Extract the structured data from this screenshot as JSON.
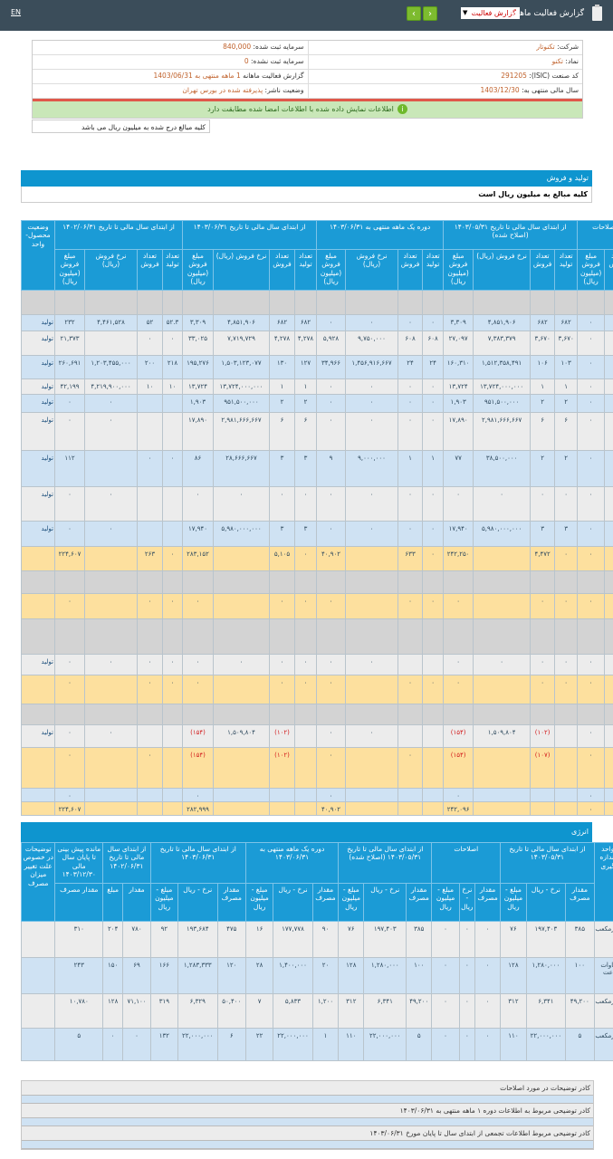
{
  "header": {
    "lang_toggle": "EN",
    "title": "گزارش فعالیت ماهانه",
    "report_select": "گزارش فعالیت",
    "prev_icon": "chevron-left-icon",
    "next_icon": "chevron-right-icon"
  },
  "info": {
    "company_label": "شرکت:",
    "company": "تکنوتار",
    "symbol_label": "نماد:",
    "symbol": "تکنو",
    "isic_label": "کد صنعت (ISIC):",
    "isic": "291205",
    "fiscal_label": "سال مالی منتهی به:",
    "fiscal": "1403/12/30",
    "reg_capital_label": "سرمایه ثبت شده:",
    "reg_capital": "840,000",
    "unreg_capital_label": "سرمایه ثبت نشده:",
    "unreg_capital": "0",
    "report_label": "گزارش فعالیت ماهانه",
    "report_value": "1 ماهه منتهی به 1403/06/31",
    "status_label": "وضعیت ناشر:",
    "status": "پذیرفته شده در بورس تهران",
    "verify_message": "اطلاعات نمایش داده شده با اطلاعات امضا شده مطابقت دارد",
    "amounts_note": "کلیه مبالغ درج شده به میلیون ریال می باشد"
  },
  "production": {
    "section_title": "تولید و فروش",
    "note": "کلیه مبالغ به میلیون ریال است",
    "status_header": "وضعیت محصول-واحد",
    "groups": [
      "از ابتدای سال مالی تا تاریخ ۱۴۰۲/۰۶/۳۱",
      "از ابتدای سال مالی تا تاریخ ۱۴۰۳/۰۶/۳۱",
      "دوره یک ماهه منتهی به ۱۴۰۳/۰۶/۳۱",
      "از ابتدای سال مالی تا تاریخ ۱۴۰۳/۰۵/۳۱ (اصلاح شده)",
      "اصلاحات"
    ],
    "subheaders": [
      "مبلغ فروش (میلیون ریال)",
      "نرخ فروش (ریال)",
      "تعداد فروش",
      "تعداد تولید"
    ],
    "rows": [
      {
        "type": "blank",
        "cells": [
          "",
          "",
          "",
          "",
          "",
          "",
          "",
          "",
          "",
          "",
          "",
          "",
          "",
          "",
          "",
          "",
          "",
          "",
          ""
        ]
      },
      {
        "type": "blue",
        "cells": [
          "تولید",
          "۲۳۲",
          "۴,۴۶۱,۵۲۸",
          "۵۲",
          "۵۲.۳",
          "۳,۳۰۹",
          "۴,۸۵۱,۹۰۶",
          "۶۸۲",
          "۶۸۲",
          "۰",
          "۰",
          "۰",
          "۰",
          "۳,۳۰۹",
          "۴,۸۵۱,۹۰۶",
          "۶۸۲",
          "۶۸۲",
          "۰",
          ""
        ]
      },
      {
        "type": "light",
        "cells": [
          "تولید",
          "۲۱,۳۷۳",
          "",
          "۰",
          "۰",
          "۳۳,۰۲۵",
          "۷,۷۱۹,۷۲۹",
          "۴,۲۷۸",
          "۴,۲۷۸",
          "۵,۹۲۸",
          "۹,۷۵۰,۰۰۰",
          "۶۰۸",
          "۶۰۸",
          "۲۷,۰۹۷",
          "۷,۳۸۳,۳۷۹",
          "۳,۶۷۰",
          "۳,۶۷۰",
          "۰",
          ""
        ]
      },
      {
        "type": "blue",
        "cells": [
          "تولید",
          "۲۶۰,۶۹۱",
          "۱,۲۰۳,۴۵۵,۰۰۰",
          "۲۰۰",
          "۲۱۸",
          "۱۹۵,۲۷۶",
          "۱,۵۰۳,۱۲۳,۰۷۷",
          "۱۳۰",
          "۱۲۷",
          "۳۴,۹۶۶",
          "۱,۴۵۶,۹۱۶,۶۶۷",
          "۲۴",
          "۲۴",
          "۱۶۰,۳۱۰",
          "۱,۵۱۲,۳۵۸,۴۹۱",
          "۱۰۶",
          "۱۰۳",
          "۰",
          ""
        ]
      },
      {
        "type": "light",
        "cells": [
          "تولید",
          "۴۲,۱۹۹",
          "۴,۲۱۹,۹۰۰,۰۰۰",
          "۱۰",
          "۱۰",
          "۱۳,۷۲۴",
          "۱۳,۷۲۴,۰۰۰,۰۰۰",
          "۱",
          "۱",
          "۰",
          "۰",
          "۰",
          "۰",
          "۱۳,۷۲۴",
          "۱۳,۷۲۴,۰۰۰,۰۰۰",
          "۱",
          "۱",
          "۰",
          ""
        ]
      },
      {
        "type": "blue",
        "cells": [
          "تولید",
          "۰",
          "۰",
          "",
          "",
          "۱,۹۰۳",
          "۹۵۱,۵۰۰,۰۰۰",
          "۲",
          "۲",
          "۰",
          "۰",
          "۰",
          "۰",
          "۱,۹۰۳",
          "۹۵۱,۵۰۰,۰۰۰",
          "۲",
          "۲",
          "۰",
          ""
        ]
      },
      {
        "type": "light",
        "cells": [
          "تولید",
          "۰",
          "۰",
          "",
          "",
          "۱۷,۸۹۰",
          "۲,۹۸۱,۶۶۶,۶۶۷",
          "۶",
          "۶",
          "۰",
          "۰",
          "۰",
          "۰",
          "۱۷,۸۹۰",
          "۲,۹۸۱,۶۶۶,۶۶۷",
          "۶",
          "۶",
          "۰",
          ""
        ]
      },
      {
        "type": "blue",
        "cells": [
          "تولید",
          "۱۱۲",
          "",
          "۰",
          "۰",
          "۸۶",
          "۲۸,۶۶۶,۶۶۷",
          "۳",
          "۳",
          "۹",
          "۹,۰۰۰,۰۰۰",
          "۱",
          "۱",
          "۷۷",
          "۳۸,۵۰۰,۰۰۰",
          "۲",
          "۲",
          "۰",
          ""
        ]
      },
      {
        "type": "light",
        "cells": [
          "تولید",
          "۰",
          "۰",
          "",
          "",
          "۰",
          "۰",
          "۰",
          "۰",
          "۰",
          "۰",
          "۰",
          "۰",
          "۰",
          "۰",
          "۰",
          "۰",
          "۰",
          ""
        ]
      },
      {
        "type": "blue",
        "cells": [
          "تولید",
          "۰",
          "۰",
          "",
          "",
          "۱۷,۹۴۰",
          "۵,۹۸۰,۰۰۰,۰۰۰",
          "۳",
          "۳",
          "۰",
          "۰",
          "۰",
          "۰",
          "۱۷,۹۴۰",
          "۵,۹۸۰,۰۰۰,۰۰۰",
          "۳",
          "۳",
          "۰",
          ""
        ]
      },
      {
        "type": "yellow",
        "cells": [
          "",
          "۲۲۴,۶۰۷",
          "",
          "۲۶۳",
          "۰",
          "۲۸۳,۱۵۲",
          "",
          "۵,۱۰۵",
          "۰",
          "۴۰,۹۰۲",
          "",
          "۶۳۳",
          "۰",
          "۲۴۲,۲۵۰",
          "",
          "۴,۴۷۲",
          "۰",
          "۰",
          ""
        ]
      },
      {
        "type": "blank",
        "cells": [
          "",
          "",
          "",
          "",
          "",
          "",
          "",
          "",
          "",
          "",
          "",
          "",
          "",
          "",
          "",
          "",
          "",
          "",
          ""
        ]
      },
      {
        "type": "yellow",
        "cells": [
          "",
          "۰",
          "",
          "۰",
          "۰",
          "۰",
          "",
          "۰",
          "۰",
          "۰",
          "",
          "۰",
          "۰",
          "۰",
          "",
          "۰",
          "۰",
          "۰",
          ""
        ]
      },
      {
        "type": "blank",
        "cells": [
          "",
          "",
          "",
          "",
          "",
          "",
          "",
          "",
          "",
          "",
          "",
          "",
          "",
          "",
          "",
          "",
          "",
          "",
          ""
        ]
      },
      {
        "type": "light",
        "cells": [
          "تولید",
          "۰",
          "۰",
          "۰",
          "۰",
          "۰",
          "۰",
          "۰",
          "۰",
          "۰",
          "۰",
          "",
          "",
          "۰",
          "۰",
          "۰",
          "۰",
          "۰",
          ""
        ]
      },
      {
        "type": "yellow",
        "cells": [
          "",
          "۰",
          "",
          "۰",
          "۰",
          "۰",
          "",
          "۰",
          "۰",
          "۰",
          "",
          "۰",
          "۰",
          "۰",
          "",
          "۰",
          "۰",
          "۰",
          ""
        ]
      },
      {
        "type": "blank",
        "cells": [
          "",
          "",
          "",
          "",
          "",
          "",
          "",
          "",
          "",
          "",
          "",
          "",
          "",
          "",
          "",
          "",
          "",
          "",
          ""
        ]
      },
      {
        "type": "light",
        "cells": [
          "تولید",
          "۰",
          "۰",
          "",
          "",
          "(۱۵۴)",
          "۱,۵۰۹,۸۰۴",
          "(۱۰۲)",
          "",
          "۰",
          "۰",
          "",
          "",
          "(۱۵۴)",
          "۱,۵۰۹,۸۰۴",
          "(۱۰۲)",
          "",
          "۰",
          ""
        ]
      },
      {
        "type": "yellow",
        "cells": [
          "",
          "۰",
          "",
          "۰",
          "",
          "(۱۵۴)",
          "",
          "(۱۰۲)",
          "",
          "۰",
          "",
          "۰",
          "",
          "(۱۵۴)",
          "",
          "(۱۰۷)",
          "",
          "۰",
          ""
        ]
      },
      {
        "type": "blue",
        "cells": [
          "",
          "۰",
          "",
          "",
          "",
          "۰",
          "",
          "",
          "",
          "۰",
          "",
          "",
          "",
          "۰",
          "",
          "",
          "",
          "۰",
          ""
        ]
      },
      {
        "type": "yellow",
        "cells": [
          "",
          "۲۲۴,۶۰۷",
          "",
          "",
          "",
          "۲۸۲,۹۹۹",
          "",
          "",
          "",
          "۴۰,۹۰۲",
          "",
          "",
          "",
          "۲۴۲,۰۹۶",
          "",
          "",
          "",
          "۰",
          ""
        ]
      }
    ]
  },
  "energy": {
    "section_title": "انرژی",
    "headers_top": [
      "توضیحات در خصوص علت تغییر میزان مصرف",
      "مانده پیش بینی تا پایان سال مالی ۱۴۰۳/۱۲/۳۰",
      "از ابتدای سال مالی تا تاریخ ۱۴۰۲/۰۶/۳۱",
      "از ابتدای سال مالی تا تاریخ ۱۴۰۳/۰۶/۳۱",
      "دوره یک ماهه منتهی به ۱۴۰۳/۰۶/۳۱",
      "از ابتدای سال مالی تا تاریخ ۱۴۰۳/۰۵/۳۱ (اصلاح شده)",
      "اصلاحات",
      "از ابتدای سال مالی تا تاریخ ۱۴۰۳/۰۵/۳۱",
      "واحد اندازه گیری"
    ],
    "headers_sub": [
      "مقدار مصرف",
      "مبلغ",
      "مقدار",
      "مبلغ - میلیون ریال",
      "نرخ - ریال",
      "مقدار مصرف",
      "مبلغ - میلیون ریال",
      "نرخ - ریال",
      "مقدار مصرف",
      "مبلغ - میلیون ریال",
      "نرخ - ریال",
      "مقدار مصرف",
      "مبلغ - میلیون ریال",
      "نرخ - ریال",
      "مقدار مصرف",
      "مبلغ - میلیون ریال",
      "نرخ - ریال",
      "مقدار مصرف"
    ],
    "rows": [
      {
        "type": "light",
        "cells": [
          "",
          "۳۱۰",
          "۲۰۴",
          "۷۸۰",
          "۹۲",
          "۱۹۳,۶۸۴",
          "۴۷۵",
          "۱۶",
          "۱۷۷,۷۷۸",
          "۹۰",
          "۷۶",
          "۱۹۷,۴۰۳",
          "۳۸۵",
          "۰",
          "۰",
          "۰",
          "۷۶",
          "۱۹۷,۴۰۳",
          "۳۸۵",
          "مترمکعب"
        ]
      },
      {
        "type": "blue",
        "cells": [
          "",
          "۲۴۳",
          "۱۵۰",
          "۶۹",
          "۱۶۶",
          "۱,۲۸۳,۳۳۳",
          "۱۲۰",
          "۲۸",
          "۱,۴۰۰,۰۰۰",
          "۲۰",
          "۱۲۸",
          "۱,۲۸۰,۰۰۰",
          "۱۰۰",
          "۰",
          "۰",
          "۰",
          "۱۲۸",
          "۱,۲۸۰,۰۰۰",
          "۱۰۰",
          "مگاوات ساعت"
        ]
      },
      {
        "type": "light",
        "cells": [
          "",
          "۱۰,۷۸۰",
          "۱۲۸",
          "۷۱,۱۰۰",
          "۳۱۹",
          "۶,۳۲۹",
          "۵۰,۴۰۰",
          "۷",
          "۵,۸۳۳",
          "۱,۲۰۰",
          "۳۱۲",
          "۶,۳۴۱",
          "۴۹,۲۰۰",
          "۰",
          "۰",
          "۰",
          "۳۱۲",
          "۶,۳۴۱",
          "۴۹,۲۰۰",
          "مترمکعب"
        ]
      },
      {
        "type": "blue",
        "cells": [
          "",
          "۵",
          "۰",
          "۰",
          "۱۳۲",
          "۲۲,۰۰۰,۰۰۰",
          "۶",
          "۲۲",
          "۲۲,۰۰۰,۰۰۰",
          "۱",
          "۱۱۰",
          "۲۲,۰۰۰,۰۰۰",
          "۵",
          "۰",
          "۰",
          "۰",
          "۱۱۰",
          "۲۲,۰۰۰,۰۰۰",
          "۵",
          "مترمکعب"
        ]
      }
    ]
  },
  "comments": [
    "کادر توضیحات در مورد اصلاحات",
    "کادر توضیحی مربوط به اطلاعات دوره ۱ ماهه منتهی به ۱۴۰۳/۰۶/۳۱",
    "کادر توضیحی مربوط اطلاعات تجمعی از ابتدای سال تا پایان مورخ ۱۴۰۳/۰۶/۳۱"
  ]
}
